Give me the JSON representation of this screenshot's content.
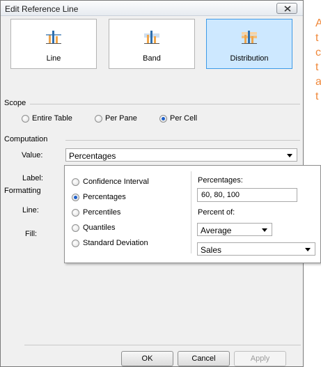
{
  "dialog": {
    "title": "Edit Reference Line",
    "tiles": [
      {
        "label": "Line"
      },
      {
        "label": "Band"
      },
      {
        "label": "Distribution"
      }
    ],
    "scope": {
      "heading": "Scope",
      "options": [
        "Entire Table",
        "Per Pane",
        "Per Cell"
      ],
      "selected": "Per Cell"
    },
    "computation": {
      "heading": "Computation",
      "value_label": "Value:",
      "value_selected": "Percentages",
      "label_label": "Label:"
    },
    "formatting": {
      "heading": "Formatting",
      "line_label": "Line:",
      "fill_label": "Fill:"
    },
    "buttons": {
      "ok": "OK",
      "cancel": "Cancel",
      "apply": "Apply"
    }
  },
  "popup": {
    "options": [
      "Confidence Interval",
      "Percentages",
      "Percentiles",
      "Quantiles",
      "Standard Deviation"
    ],
    "selected": "Percentages",
    "percentages_label": "Percentages:",
    "percentages_value": "60, 80, 100",
    "percent_of_label": "Percent of:",
    "aggregation": "Average",
    "measure": "Sales"
  },
  "help_text": {
    "lines": [
      "A",
      "t",
      "c",
      "t",
      "a",
      "t"
    ]
  },
  "colors": {
    "accent": "#3d9ae8",
    "selected_tile_bg": "#cde8ff",
    "help_text": "#f0883a",
    "bar_orange": "#f0a64b",
    "bar_blue": "#2f6fad"
  }
}
